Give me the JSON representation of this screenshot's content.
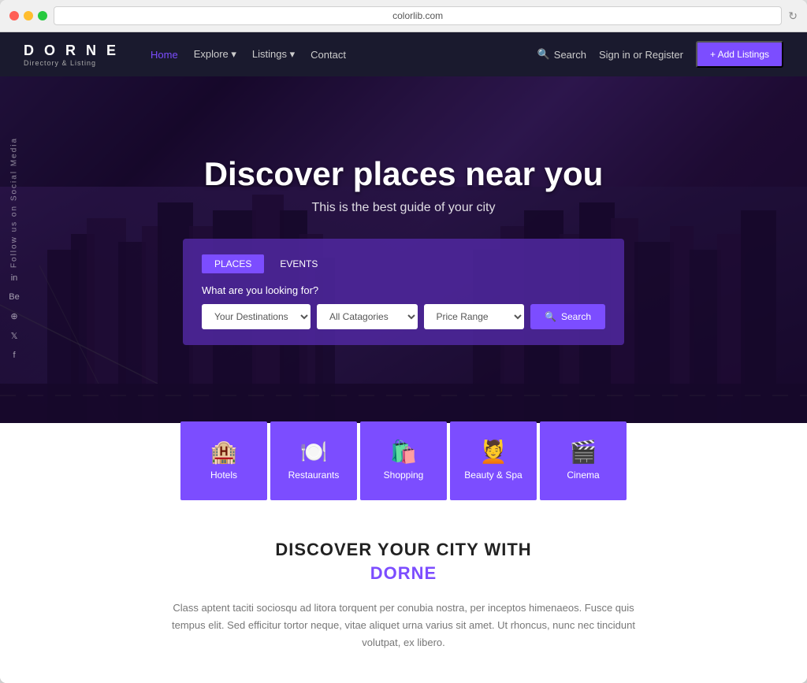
{
  "browser": {
    "url": "colorlib.com",
    "dots": [
      "red",
      "yellow",
      "green"
    ]
  },
  "navbar": {
    "logo_title": "D O R N E",
    "logo_subtitle": "Directory & Listing",
    "links": [
      {
        "label": "Home",
        "active": true
      },
      {
        "label": "Explore",
        "has_dropdown": true
      },
      {
        "label": "Listings",
        "has_dropdown": true
      },
      {
        "label": "Contact",
        "has_dropdown": false
      }
    ],
    "search_label": "Search",
    "sign_label": "Sign in or Register",
    "add_btn": "+ Add Listings"
  },
  "hero": {
    "title": "Discover places near you",
    "subtitle": "This is the best guide of your city",
    "social_label": "Follow us on Social Media",
    "social_icons": [
      "in",
      "Be",
      "⊕",
      "𝕏",
      "f"
    ],
    "search_tabs": [
      "PLACES",
      "EVENTS"
    ],
    "search_label": "What are you looking for?",
    "search_fields": {
      "destination_placeholder": "Your Destinations",
      "category_placeholder": "All Catagories",
      "price_placeholder": "Price Range"
    },
    "search_button": "Search"
  },
  "categories": [
    {
      "label": "Hotels",
      "icon": "🏨"
    },
    {
      "label": "Restaurants",
      "icon": "🍽️"
    },
    {
      "label": "Shopping",
      "icon": "🛍️"
    },
    {
      "label": "Beauty & Spa",
      "icon": "💆"
    },
    {
      "label": "Cinema",
      "icon": "🎬"
    }
  ],
  "discover_section": {
    "heading": "DISCOVER YOUR CITY WITH",
    "brand": "DORNE",
    "text": "Class aptent taciti sociosqu ad litora torquent per conubia nostra, per inceptos himenaeos. Fusce quis tempus elit. Sed efficitur tortor neque, vitae aliquet urna varius sit amet. Ut rhoncus, nunc nec tincidunt volutpat, ex libero."
  }
}
